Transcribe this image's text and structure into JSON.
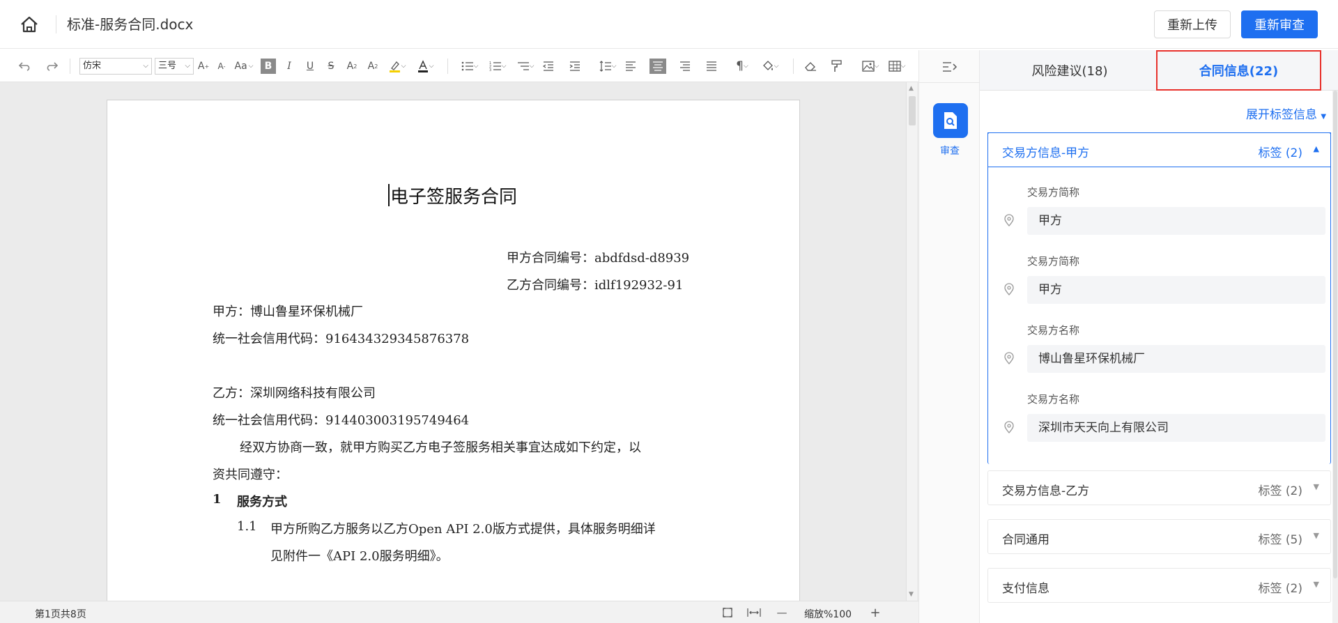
{
  "header": {
    "doc_title": "标准-服务合同.docx",
    "reupload_label": "重新上传",
    "rereview_label": "重新审查"
  },
  "toolbar": {
    "font_family": "仿宋",
    "font_size": "三号",
    "bold": "B",
    "italic": "I",
    "underline": "U",
    "strike": "S",
    "aa": "Aa",
    "grow": "A",
    "shrink": "A",
    "pilcrow": "¶"
  },
  "document": {
    "title": "电子签服务合同",
    "party_a_no": "甲方合同编号：abdfdsd-d8939",
    "party_b_no": "乙方合同编号：idlf192932-91",
    "party_a": "甲方：博山鲁星环保机械厂",
    "party_a_code": "统一社会信用代码：916434329345876378",
    "party_b": "乙方：深圳网络科技有限公司",
    "party_b_code": "统一社会信用代码：914403003195749464",
    "para1_line1": "经双方协商一致，就甲方购买乙方电子签服务相关事宜达成如下约定，以",
    "para1_line2": "资共同遵守：",
    "sec1_no": "1",
    "sec1_title": "服务方式",
    "item11_no": "1.1",
    "item11_line1": "甲方所购乙方服务以乙方Open  API  2.0版方式提供，具体服务明细详",
    "item11_line2": "见附件一《API 2.0服务明细》。"
  },
  "statusbar": {
    "page_info": "第1页共8页",
    "zoom": "缩放%100",
    "minus": "—",
    "plus": "+"
  },
  "rail": {
    "review_label": "审查"
  },
  "panel": {
    "tab_risk": "风险建议(18)",
    "tab_info": "合同信息(22)",
    "expand_link": "展开标签信息",
    "sections": [
      {
        "title": "交易方信息-甲方",
        "tag": "标签 (2)",
        "fields": [
          {
            "label": "交易方简称",
            "value": "甲方"
          },
          {
            "label": "交易方简称",
            "value": "甲方"
          },
          {
            "label": "交易方名称",
            "value": "博山鲁星环保机械厂"
          },
          {
            "label": "交易方名称",
            "value": "深圳市天天向上有限公司"
          }
        ]
      },
      {
        "title": "交易方信息-乙方",
        "tag": "标签 (2)"
      },
      {
        "title": "合同通用",
        "tag": "标签 (5)"
      },
      {
        "title": "支付信息",
        "tag": "标签 (2)"
      }
    ]
  },
  "colors": {
    "accent": "#1e6ff0",
    "highlight_border": "#e8302b"
  }
}
